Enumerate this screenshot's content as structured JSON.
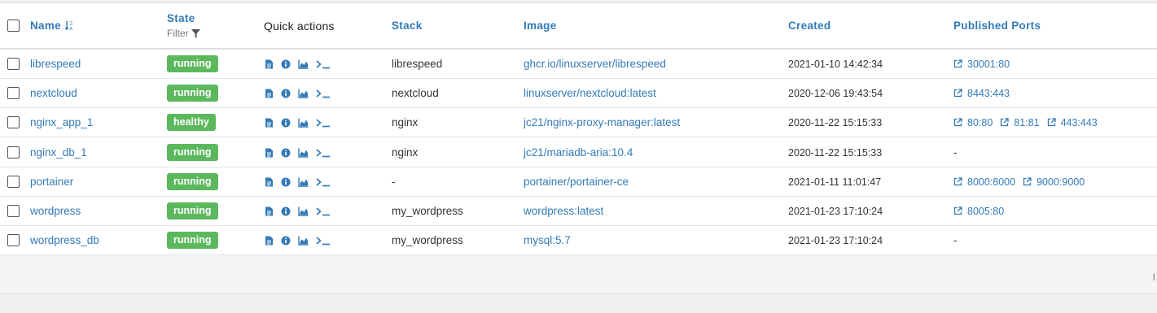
{
  "header": {
    "name": "Name",
    "state": "State",
    "filter": "Filter",
    "quick_actions": "Quick actions",
    "stack": "Stack",
    "image": "Image",
    "created": "Created",
    "published_ports": "Published Ports"
  },
  "containers": [
    {
      "name": "librespeed",
      "state": "running",
      "stack": "librespeed",
      "image": "ghcr.io/linuxserver/librespeed",
      "created": "2021-01-10 14:42:34",
      "ports": [
        "30001:80"
      ]
    },
    {
      "name": "nextcloud",
      "state": "running",
      "stack": "nextcloud",
      "image": "linuxserver/nextcloud:latest",
      "created": "2020-12-06 19:43:54",
      "ports": [
        "8443:443"
      ]
    },
    {
      "name": "nginx_app_1",
      "state": "healthy",
      "stack": "nginx",
      "image": "jc21/nginx-proxy-manager:latest",
      "created": "2020-11-22 15:15:33",
      "ports": [
        "80:80",
        "81:81",
        "443:443"
      ]
    },
    {
      "name": "nginx_db_1",
      "state": "running",
      "stack": "nginx",
      "image": "jc21/mariadb-aria:10.4",
      "created": "2020-11-22 15:15:33",
      "ports": []
    },
    {
      "name": "portainer",
      "state": "running",
      "stack": "-",
      "image": "portainer/portainer-ce",
      "created": "2021-01-11 11:01:47",
      "ports": [
        "8000:8000",
        "9000:9000"
      ]
    },
    {
      "name": "wordpress",
      "state": "running",
      "stack": "my_wordpress",
      "image": "wordpress:latest",
      "created": "2021-01-23 17:10:24",
      "ports": [
        "8005:80"
      ]
    },
    {
      "name": "wordpress_db",
      "state": "running",
      "stack": "my_wordpress",
      "image": "mysql:5.7",
      "created": "2021-01-23 17:10:24",
      "ports": []
    }
  ],
  "empty_ports": "-",
  "footer_fragment": "I",
  "colors": {
    "badge": "#5cb85c",
    "link": "#337ab7"
  },
  "icons": [
    "logs-icon",
    "inspect-icon",
    "stats-icon",
    "console-icon",
    "external-link-icon",
    "filter-icon",
    "sort-icon"
  ]
}
